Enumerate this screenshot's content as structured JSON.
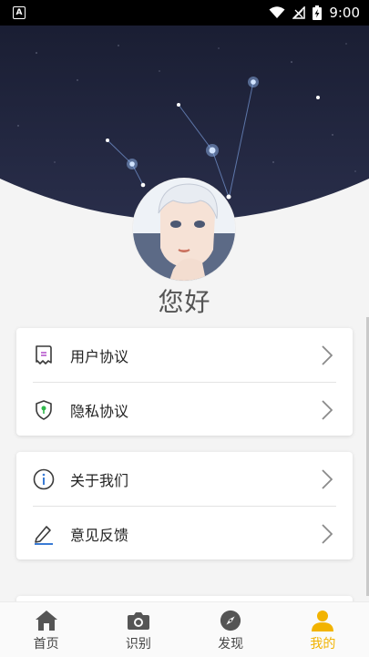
{
  "status_bar": {
    "time": "9:00",
    "icons": [
      "a-notification-icon",
      "wifi-icon",
      "signal-icon",
      "battery-charging-icon"
    ]
  },
  "profile": {
    "greeting": "您好"
  },
  "menu": {
    "group1": [
      {
        "icon": "document-icon",
        "label": "用户协议"
      },
      {
        "icon": "shield-icon",
        "label": "隐私协议"
      }
    ],
    "group2": [
      {
        "icon": "info-icon",
        "label": "关于我们"
      },
      {
        "icon": "pencil-icon",
        "label": "意见反馈"
      }
    ]
  },
  "bottom_nav": [
    {
      "icon": "home-icon",
      "label": "首页",
      "active": false
    },
    {
      "icon": "camera-icon",
      "label": "识别",
      "active": false
    },
    {
      "icon": "compass-icon",
      "label": "发现",
      "active": false
    },
    {
      "icon": "person-icon",
      "label": "我的",
      "active": true
    }
  ],
  "colors": {
    "accent": "#f2b300",
    "inactive_nav": "#555555",
    "banner_sky": "#1e2238"
  }
}
